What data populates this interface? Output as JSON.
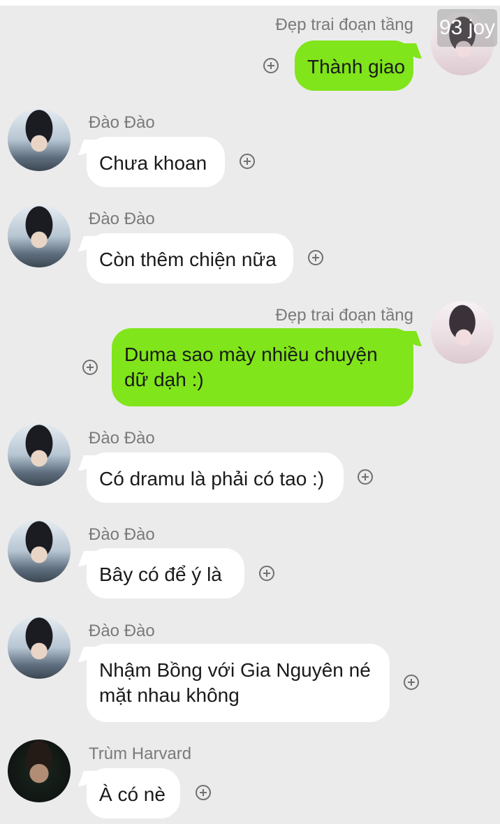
{
  "watermark": "93 joy",
  "messages": [
    {
      "sender": "Đẹp trai đoạn tầng",
      "direction": "outgoing",
      "avatar": "me-avatar",
      "lines": [
        "Thành giao"
      ]
    },
    {
      "sender": "Đào Đào",
      "direction": "incoming",
      "avatar": "dao-avatar",
      "lines": [
        "Chưa khoan"
      ]
    },
    {
      "sender": "Đào Đào",
      "direction": "incoming",
      "avatar": "dao-avatar",
      "lines": [
        "Còn thêm chiện nữa"
      ]
    },
    {
      "sender": "Đẹp trai đoạn tầng",
      "direction": "outgoing",
      "avatar": "me-avatar",
      "lines": [
        "Duma sao mày nhiều chuyện",
        "dữ dạh :)"
      ]
    },
    {
      "sender": "Đào Đào",
      "direction": "incoming",
      "avatar": "dao-avatar",
      "lines": [
        "Có dramu là phải có tao :)"
      ]
    },
    {
      "sender": "Đào Đào",
      "direction": "incoming",
      "avatar": "dao-avatar",
      "lines": [
        "Bây có để ý là"
      ]
    },
    {
      "sender": "Đào Đào",
      "direction": "incoming",
      "avatar": "dao-avatar",
      "lines": [
        "Nhậm Bồng với Gia Nguyên né",
        "mặt nhau không"
      ]
    },
    {
      "sender": "Trùm Harvard",
      "direction": "incoming",
      "avatar": "trum-avatar",
      "lines": [
        "À có nè"
      ]
    }
  ],
  "colors": {
    "background": "#ebebeb",
    "outgoing_bubble": "#80e51a",
    "incoming_bubble": "#ffffff",
    "name_text": "#7a7a7a"
  },
  "icons": [
    "add-reaction-icon"
  ]
}
